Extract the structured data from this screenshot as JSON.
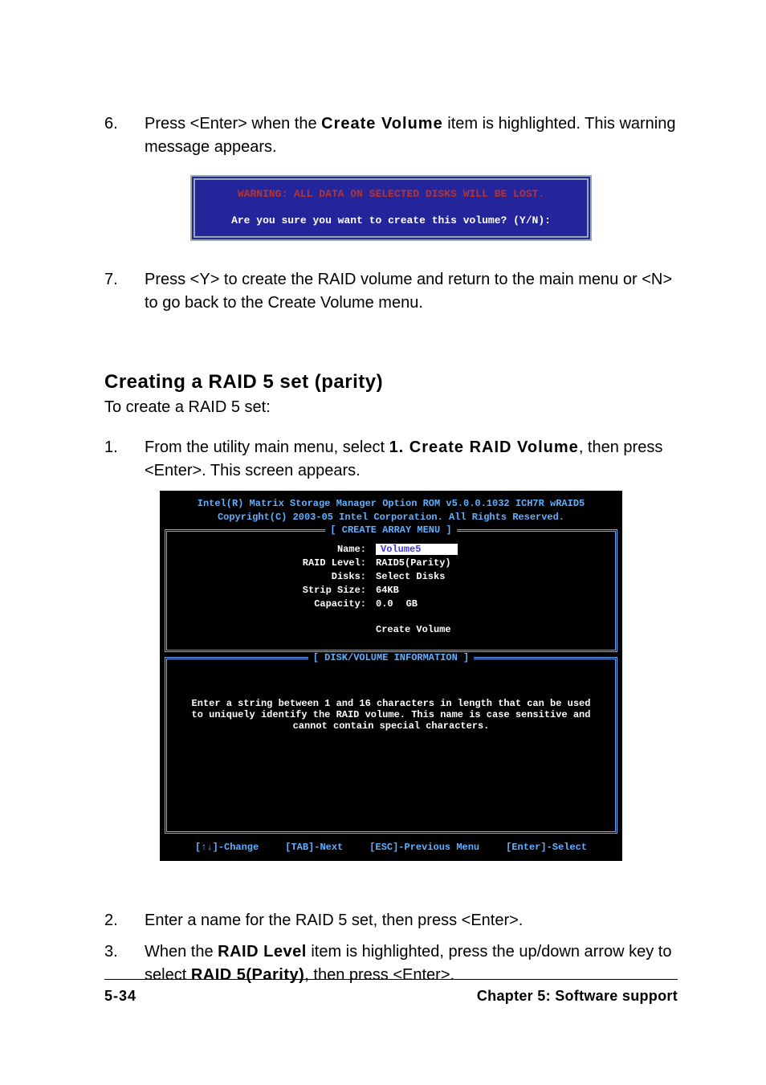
{
  "step6": {
    "num": "6.",
    "text_a": "Press <Enter> when the ",
    "bold": "Create Volume",
    "text_b": " item is highlighted. This warning message appears."
  },
  "warn_box": {
    "line1": "WARNING: ALL DATA ON SELECTED DISKS WILL BE LOST.",
    "line2": "Are you sure you want to create this volume? (Y/N):"
  },
  "step7": {
    "num": "7.",
    "text": "Press <Y> to create the RAID volume and return to the main menu or <N> to go back to the Create Volume menu."
  },
  "heading": "Creating a RAID 5 set (parity)",
  "heading_sub": "To create a RAID 5 set:",
  "step1": {
    "num": "1.",
    "text_a": "From the utility main menu, select ",
    "bold": "1. Create RAID Volume",
    "text_b": ", then press <Enter>. This screen appears."
  },
  "bios": {
    "head1": "Intel(R) Matrix Storage Manager Option ROM v5.0.0.1032 ICH7R wRAID5",
    "head2": "Copyright(C) 2003-05 Intel Corporation. All Rights Reserved.",
    "panel1_title": "[ CREATE ARRAY MENU ]",
    "rows": {
      "name_label": "Name:",
      "name_value": "Volume5",
      "raid_level_label": "RAID Level:",
      "raid_level_value": "RAID5(Parity)",
      "disks_label": "Disks:",
      "disks_value": "Select Disks",
      "strip_label": "Strip Size:",
      "strip_value": "64KB",
      "capacity_label": "Capacity:",
      "capacity_value_a": "0.0",
      "capacity_value_b": "GB"
    },
    "create_volume": "Create Volume",
    "panel2_title": "[ DISK/VOLUME INFORMATION ]",
    "info_line1": "Enter a string between 1 and 16 characters in length that can be used",
    "info_line2": "to uniquely identify the RAID volume. This name is case sensitive and",
    "info_line3": "cannot contain special characters.",
    "keys": {
      "k1": "[↑↓]-Change",
      "k2": "[TAB]-Next",
      "k3": "[ESC]-Previous Menu",
      "k4": "[Enter]-Select"
    }
  },
  "step2": {
    "num": "2.",
    "text": "Enter a name for the RAID 5 set, then press <Enter>."
  },
  "step3": {
    "num": "3.",
    "text_a": "When the ",
    "bold_a": "RAID Level",
    "text_b": " item is highlighted, press the up/down arrow key to select ",
    "bold_b": "RAID 5(Parity)",
    "text_c": ", then press <Enter>."
  },
  "footer": {
    "page_num": "5-34",
    "chapter": "Chapter 5: Software support"
  }
}
